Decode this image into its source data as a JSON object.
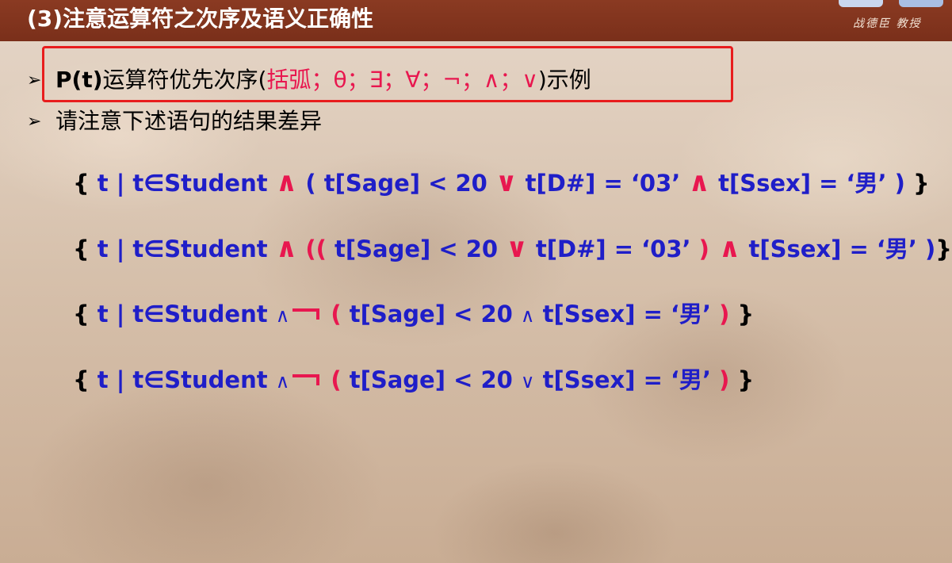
{
  "header": {
    "title": "(3)注意运算符之次序及语义正确性",
    "logo_text": "战德臣 教授"
  },
  "bullets": [
    {
      "mark": "➢",
      "prefix": "P(t)",
      "mid": "运算符优先次序(",
      "ops": "括弧；θ；∃；∀；¬；∧；∨",
      "suffix": ")示例"
    },
    {
      "mark": "➢",
      "text": "请注意下述语句的结果差异"
    }
  ],
  "formulas": [
    {
      "open": "{",
      "head": " t |  t∈Student ",
      "and1": "∧",
      "p1": " ( t[Sage] < 20 ",
      "or1": "∨",
      "p2": "  t[D#] = ‘03’   ",
      "and2": "∧",
      "p3": " t[Ssex] = ‘男’ ) ",
      "close": "}"
    },
    {
      "open": "{",
      "head": " t |  t∈Student ",
      "and1": "∧",
      "lparen": " ((",
      "p1": " t[Sage] < 20 ",
      "or1": "∨",
      "p2": "  t[D#] = ‘03’ ",
      "rparen": ")",
      "and2": " ∧",
      "p3": " t[Ssex] = ‘男’ )",
      "close": "}"
    },
    {
      "open": "{",
      "head": " t |  t∈Student ",
      "and1": "∧",
      "lparen": " (",
      "p1": " t[Sage] < 20  ",
      "op": "∧",
      "p2": " t[Ssex] = ‘男’ ",
      "rparen": ")",
      "close": " }"
    },
    {
      "open": "{",
      "head": " t |  t∈Student ",
      "and1": "∧",
      "lparen": " (",
      "p1": " t[Sage] < 20 ",
      "op": "∨",
      "p2": " t[Ssex] = ‘男’ ",
      "rparen": ")",
      "close": " }"
    }
  ],
  "colors": {
    "header_bg": "#7a2f1a",
    "highlight_border": "#e81d1d",
    "formula_text": "#1f1ec8",
    "operator": "#e8174f"
  }
}
